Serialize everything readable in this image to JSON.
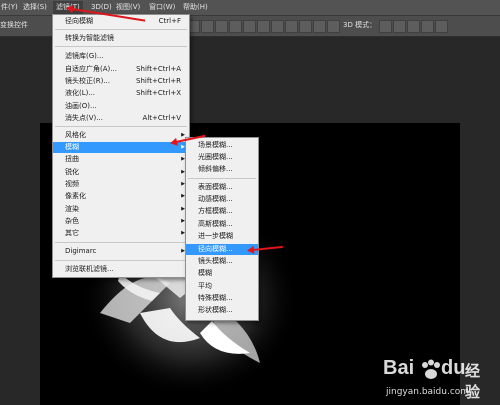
{
  "menubar": {
    "items": [
      "件(Y)",
      "选择(S)",
      "滤镜(T)",
      "3D(D)",
      "视图(V)",
      "窗口(W)",
      "帮助(H)"
    ]
  },
  "options_bar": {
    "transform_label": "变换控件",
    "mode_3d_label": "3D 模式："
  },
  "filter_menu": {
    "items": [
      {
        "label": "径向模糊",
        "shortcut": "Ctrl+F"
      },
      {
        "label": "转换为智能滤镜",
        "shortcut": ""
      },
      {
        "label": "滤镜库(G)...",
        "shortcut": ""
      },
      {
        "label": "自适应广角(A)...",
        "shortcut": "Shift+Ctrl+A"
      },
      {
        "label": "镜头校正(R)...",
        "shortcut": "Shift+Ctrl+R"
      },
      {
        "label": "液化(L)...",
        "shortcut": "Shift+Ctrl+X"
      },
      {
        "label": "油画(O)...",
        "shortcut": ""
      },
      {
        "label": "消失点(V)...",
        "shortcut": "Alt+Ctrl+V"
      },
      {
        "label": "风格化",
        "shortcut": ""
      },
      {
        "label": "模糊",
        "shortcut": ""
      },
      {
        "label": "扭曲",
        "shortcut": ""
      },
      {
        "label": "锐化",
        "shortcut": ""
      },
      {
        "label": "视频",
        "shortcut": ""
      },
      {
        "label": "像素化",
        "shortcut": ""
      },
      {
        "label": "渲染",
        "shortcut": ""
      },
      {
        "label": "杂色",
        "shortcut": ""
      },
      {
        "label": "其它",
        "shortcut": ""
      },
      {
        "label": "Digimarc",
        "shortcut": ""
      },
      {
        "label": "浏览联机滤镜...",
        "shortcut": ""
      }
    ]
  },
  "blur_submenu": {
    "items": [
      "场景模糊...",
      "光圈模糊...",
      "倾斜偏移...",
      "表面模糊...",
      "动感模糊...",
      "方框模糊...",
      "高斯模糊...",
      "进一步模糊",
      "径向模糊...",
      "镜头模糊...",
      "模糊",
      "平均",
      "特殊模糊...",
      "形状模糊..."
    ]
  },
  "watermark": {
    "brand": "Bai",
    "brand2": "du",
    "product": "经验",
    "url": "jingyan.baidu.com"
  },
  "colors": {
    "highlight": "#3399ff",
    "annotation_arrow": "#e0141a",
    "menu_bg": "#f0f0f0"
  }
}
